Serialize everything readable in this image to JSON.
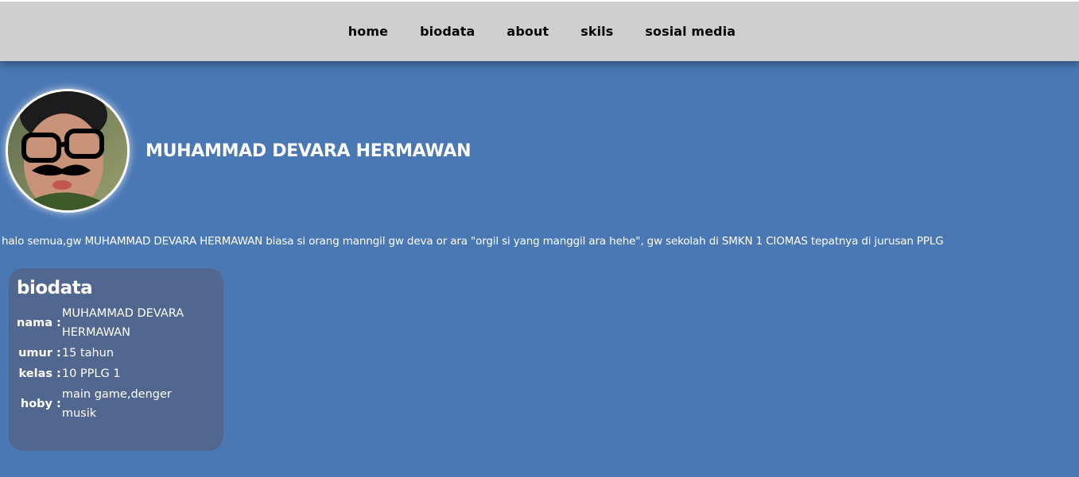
{
  "nav": {
    "items": [
      {
        "label": "home"
      },
      {
        "label": "biodata"
      },
      {
        "label": "about"
      },
      {
        "label": "skils"
      },
      {
        "label": "sosial media"
      }
    ]
  },
  "profile": {
    "name": "MUHAMMAD DEVARA HERMAWAN",
    "intro": "halo semua,gw MUHAMMAD DEVARA HERMAWAN biasa si orang manngil gw deva or ara \"orgil si yang manggil ara hehe\", gw sekolah di SMKN 1 CIOMAS tepatnya di jurusan PPLG"
  },
  "biodata": {
    "title": "biodata",
    "rows": [
      {
        "key": "nama :",
        "value": "MUHAMMAD DEVARA HERMAWAN"
      },
      {
        "key": "umur :",
        "value": "15 tahun"
      },
      {
        "key": "kelas :",
        "value": "10 PPLG 1"
      },
      {
        "key": "hoby :",
        "value": "main game,denger musik"
      }
    ]
  },
  "colors": {
    "background": "#4a78b5",
    "navbar": "#cfcfcf",
    "card": "#52678f",
    "text": "#ffffff"
  }
}
